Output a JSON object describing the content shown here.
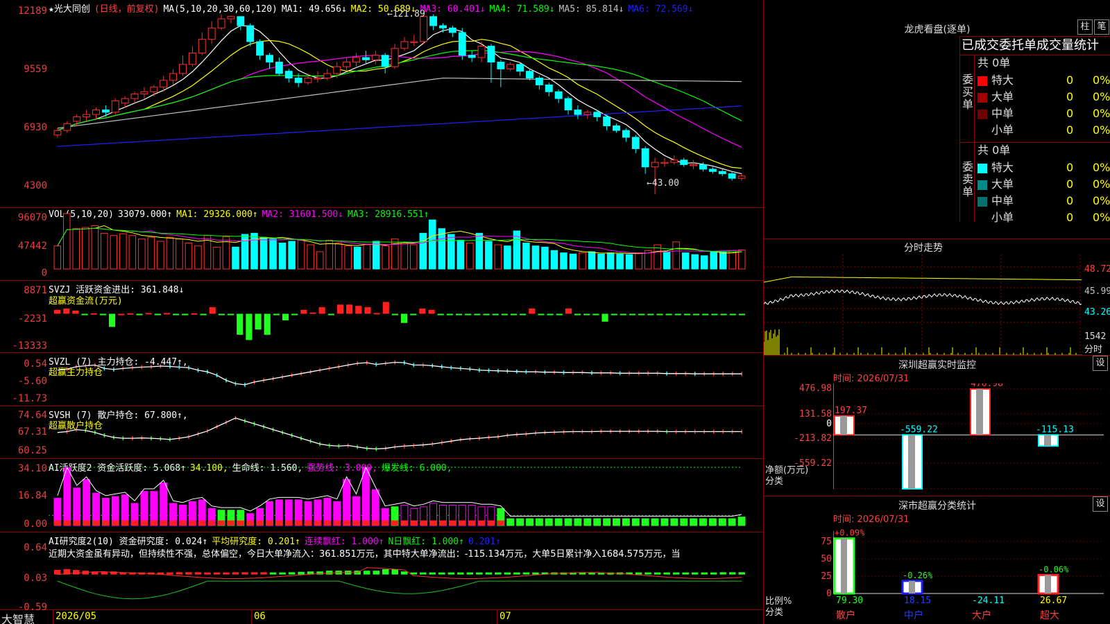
{
  "main": {
    "title": "★光大同创",
    "mode": "(日线，前复权)",
    "ma_label": "MA(5,10,20,30,60,120)",
    "ma": [
      {
        "text": "MA1: 49.656↓",
        "color": "#ffffff"
      },
      {
        "text": "MA2: 50.689↓",
        "color": "#ffff00"
      },
      {
        "text": "MA3: 60.401↓",
        "color": "#ff00ff"
      },
      {
        "text": "MA4: 71.589↓",
        "color": "#00ff00"
      },
      {
        "text": "MA5: 85.814↓",
        "color": "#c0c0c0"
      },
      {
        "text": "MA6: 72.569↓",
        "color": "#2020ff"
      }
    ],
    "y_ticks": [
      "12189",
      "9559",
      "6930",
      "4300"
    ],
    "high_note": "121.89",
    "low_note": "43.00"
  },
  "vol": {
    "label": "VOL(5,10,20)",
    "value": "33079.000↑",
    "ma": [
      {
        "text": "MA1: 29326.000↑",
        "color": "#ffff00"
      },
      {
        "text": "MA2: 31601.500↓",
        "color": "#ff00ff"
      },
      {
        "text": "MA3: 28916.551↑",
        "color": "#00ff00"
      }
    ],
    "y_ticks": [
      "96070",
      "47442",
      "0"
    ]
  },
  "svzj": {
    "label": "SVZJ  活跃资金进出: 361.848↓",
    "sub": "超赢资金流(万元)",
    "y_ticks": [
      "8871",
      "-2231",
      "-13333"
    ]
  },
  "svzl": {
    "label": "SVZL (7) 主力持仓: -4.447↑,",
    "sub": "超赢主力持仓",
    "y_ticks": [
      "0.54",
      "-5.60",
      "-11.73"
    ]
  },
  "svsh": {
    "label": "SVSH (7) 散户持仓: 67.800↑,",
    "sub": "超赢散户持仓",
    "y_ticks": [
      "74.64",
      "67.31",
      "60.25"
    ]
  },
  "ai1": {
    "label": "AI活跃度2 资金活跃度: 5.068↑",
    "v2": "34.100,",
    "v3": "生命线: 1.560,",
    "v4": "强势线: 3.000,",
    "v5": "爆发线: 6.000,",
    "y_ticks": [
      "34.10",
      "16.84",
      "0.00"
    ]
  },
  "ai2": {
    "label": "AI研究度2(10) 资金研究度: 0.024↑",
    "v2": "平均研究度: 0.201↑",
    "v3": "连续飘红: 1.000↑",
    "v4": "N日飘红: 1.000↑",
    "v5": "0.201↑",
    "text": "近期大资金虽有异动，但持续性不强，总体偏空，今日大单净流入：361.851万元，其中特大单净流出：-115.134万元，大单5日累计净入1684.575万元，当",
    "y_ticks": [
      "0.64",
      "0.03",
      "-0.59"
    ]
  },
  "bottom": {
    "brand": "大智慧",
    "dates": [
      "2026/05",
      "06",
      "07"
    ]
  },
  "lhb": {
    "title": "龙虎看盘(逐单)",
    "btn1": "柱",
    "btn2": "笔",
    "tabs": "已成交委托单成交量统计",
    "buy_label": "委买单",
    "sell_label": "委卖单",
    "buy_total": "共 0单",
    "sell_total": "共 0单",
    "buy_rows": [
      {
        "name": "特大",
        "v": "0",
        "p": "0%",
        "color": "#ff0000"
      },
      {
        "name": "大单",
        "v": "0",
        "p": "0%",
        "color": "#a00000"
      },
      {
        "name": "中单",
        "v": "0",
        "p": "0%",
        "color": "#700000"
      },
      {
        "name": "小单",
        "v": "0",
        "p": "0%",
        "color": "#000000"
      }
    ],
    "sell_rows": [
      {
        "name": "特大",
        "v": "0",
        "p": "0%",
        "color": "#00ffff"
      },
      {
        "name": "大单",
        "v": "0",
        "p": "0%",
        "color": "#008b8b"
      },
      {
        "name": "中单",
        "v": "0",
        "p": "0%",
        "color": "#007070"
      },
      {
        "name": "小单",
        "v": "0",
        "p": "0%",
        "color": "#000000"
      }
    ]
  },
  "fs": {
    "title": "分时走势",
    "y": [
      "48.72",
      "45.99",
      "43.26",
      "1542"
    ],
    "unit": "分时"
  },
  "sz": {
    "title": "深圳超赢实时监控",
    "btn": "设",
    "time": "时间: 2026/07/31",
    "y": [
      "476.98",
      "131.58",
      "0",
      "-213.82",
      "-559.22"
    ],
    "unit1": "净额(万元)",
    "unit2": "分类",
    "bars": [
      {
        "cat": "散户",
        "val": "197.37"
      },
      {
        "cat": "中户",
        "val": "-559.22"
      },
      {
        "cat": "大户",
        "val": "476.98"
      },
      {
        "cat": "超大",
        "val": "-115.13"
      }
    ]
  },
  "fl": {
    "title": "深市超赢分类统计",
    "btn": "设",
    "time": "时间: 2026/07/31",
    "y": [
      "75",
      "50",
      "25",
      "0"
    ],
    "unit1": "比例%",
    "unit2": "分类",
    "bars": [
      {
        "cat": "散户",
        "pct": "+0.09%",
        "val": "79.30"
      },
      {
        "cat": "中户",
        "pct": "-0.26%",
        "val": "18.15"
      },
      {
        "cat": "大户",
        "pct": "",
        "val": "-24.11"
      },
      {
        "cat": "超大",
        "pct": "-0.06%",
        "val": "26.67"
      }
    ]
  },
  "chart_data": [
    {
      "type": "candlestick",
      "title": "光大同创 日线 前复权",
      "ylim": [
        43.0,
        121.89
      ],
      "candles": [
        [
          69,
          71,
          72,
          68
        ],
        [
          71,
          74,
          75,
          70
        ],
        [
          75,
          77,
          78,
          73
        ],
        [
          77,
          78,
          80,
          75
        ],
        [
          78,
          80,
          81,
          76
        ],
        [
          80,
          79,
          82,
          77
        ],
        [
          79,
          84,
          85,
          78
        ],
        [
          83,
          85,
          86,
          81
        ],
        [
          85,
          87,
          88,
          83
        ],
        [
          87,
          88,
          90,
          85
        ],
        [
          88,
          90,
          91,
          86
        ],
        [
          90,
          93,
          95,
          88
        ],
        [
          93,
          96,
          98,
          91
        ],
        [
          96,
          100,
          104,
          95
        ],
        [
          100,
          105,
          108,
          99
        ],
        [
          105,
          111,
          114,
          104
        ],
        [
          111,
          116,
          119,
          109
        ],
        [
          116,
          120,
          121.89,
          115
        ],
        [
          120,
          121,
          121.5,
          118
        ],
        [
          121,
          117,
          121,
          115
        ],
        [
          117,
          110,
          118,
          108
        ],
        [
          110,
          104,
          111,
          102
        ],
        [
          104,
          101,
          105,
          98
        ],
        [
          101,
          96,
          103,
          95
        ],
        [
          97,
          94,
          98,
          92
        ],
        [
          94,
          92,
          96,
          90
        ],
        [
          92,
          94,
          96,
          91
        ],
        [
          94,
          94,
          97,
          92
        ],
        [
          94,
          96,
          98,
          93
        ],
        [
          96,
          99,
          101,
          94
        ],
        [
          99,
          101,
          103,
          97
        ],
        [
          101,
          103,
          105,
          99
        ],
        [
          103,
          102,
          106,
          100
        ],
        [
          102,
          104,
          106,
          100
        ],
        [
          104,
          99,
          105,
          96
        ],
        [
          99,
          107,
          109,
          98
        ],
        [
          107,
          110,
          112,
          106
        ],
        [
          110,
          110,
          113,
          108
        ],
        [
          110,
          121,
          122,
          109
        ],
        [
          121,
          117,
          122,
          115
        ],
        [
          117,
          116,
          118,
          114
        ],
        [
          116,
          114,
          117,
          112
        ],
        [
          114,
          104,
          116,
          102
        ],
        [
          104,
          103,
          106,
          101
        ],
        [
          103,
          108,
          110,
          101
        ],
        [
          108,
          101,
          109,
          92
        ],
        [
          101,
          98,
          102,
          90
        ],
        [
          98,
          100,
          101,
          97
        ],
        [
          100,
          97,
          101,
          95
        ],
        [
          97,
          94,
          98,
          93
        ],
        [
          94,
          91,
          95,
          89
        ],
        [
          91,
          88,
          92,
          86
        ],
        [
          88,
          85,
          89,
          83
        ],
        [
          85,
          80,
          86,
          78
        ],
        [
          80,
          78,
          82,
          76
        ],
        [
          78,
          79,
          80,
          76
        ],
        [
          79,
          77,
          80,
          75
        ],
        [
          77,
          73,
          78,
          71
        ],
        [
          73,
          71,
          74,
          70
        ],
        [
          71,
          68,
          72,
          66
        ],
        [
          68,
          63,
          69,
          61
        ],
        [
          63,
          55,
          64,
          52
        ],
        [
          55,
          57,
          59,
          43
        ],
        [
          57,
          57,
          59,
          55
        ],
        [
          57,
          58,
          60,
          56
        ],
        [
          58,
          56,
          59,
          55
        ],
        [
          56,
          56,
          58,
          54
        ],
        [
          56,
          54,
          57,
          53
        ],
        [
          54,
          53,
          55,
          52
        ],
        [
          53,
          52,
          54,
          51
        ],
        [
          52,
          50,
          53,
          49
        ],
        [
          50,
          51,
          52,
          49
        ]
      ]
    },
    {
      "type": "bar",
      "title": "VOL(5,10,20)",
      "ylim": [
        0,
        96070
      ],
      "values": [
        40000,
        96070,
        70000,
        72000,
        75000,
        62000,
        58000,
        61000,
        58000,
        52000,
        55000,
        48000,
        55000,
        52000,
        45000,
        40000,
        58000,
        38000,
        56000,
        38000,
        60000,
        62000,
        55000,
        52000,
        45000,
        48000,
        50000,
        42000,
        30000,
        50000,
        45000,
        40000,
        38000,
        42000,
        48000,
        40000,
        52000,
        45000,
        42000,
        62000,
        85000,
        70000,
        60000,
        50000,
        45000,
        62000,
        48000,
        42000,
        40000,
        66000,
        45000,
        40000,
        38000,
        32000,
        28000,
        26000,
        28000,
        30000,
        26000,
        28000,
        26000,
        25000,
        28000,
        32000,
        42000,
        30000,
        47000,
        28000,
        25000,
        23000,
        30000,
        30000,
        32000,
        33079
      ],
      "up": [
        1,
        1,
        1,
        1,
        1,
        1,
        1,
        1,
        1,
        1,
        1,
        1,
        1,
        1,
        1,
        1,
        1,
        1,
        1,
        0,
        0,
        0,
        0,
        0,
        0,
        0,
        1,
        1,
        1,
        1,
        1,
        1,
        0,
        1,
        0,
        1,
        1,
        1,
        1,
        0,
        0,
        0,
        0,
        0,
        1,
        0,
        0,
        1,
        0,
        0,
        0,
        0,
        0,
        0,
        0,
        0,
        1,
        0,
        0,
        0,
        0,
        0,
        1,
        1,
        1,
        0,
        1,
        0,
        0,
        0,
        0,
        0,
        1,
        1
      ]
    },
    {
      "type": "bar",
      "title": "超赢资金流(万元)",
      "ylim": [
        -13333,
        8871
      ],
      "values": [
        1500,
        2000,
        1200,
        -200,
        200,
        -300,
        -5000,
        0,
        200,
        -200,
        300,
        -200,
        300,
        -400,
        -300,
        200,
        -300,
        2500,
        -200,
        -300,
        -8000,
        -10000,
        -6000,
        -8000,
        -200,
        -2500,
        -300,
        1500,
        500,
        2500,
        -300,
        3500,
        3500,
        3000,
        2500,
        300,
        4500,
        -200,
        -3500,
        -300,
        2000,
        1500,
        -200,
        -200,
        -200,
        -200,
        -200,
        -200,
        -200,
        -200,
        -200,
        -200,
        2000,
        -200,
        -200,
        -200,
        2000,
        -200,
        -200,
        -200,
        -3000,
        -200,
        -200,
        -200,
        -200,
        -200,
        -200,
        -200,
        -200,
        -200,
        -200,
        -200,
        -200,
        -200,
        -200,
        -200
      ],
      "sign": "positive=red, negative=green"
    },
    {
      "type": "line",
      "title": "超赢主力持仓",
      "ylim": [
        -11.73,
        0.54
      ],
      "values": [
        -2.5,
        -2.2,
        -1.5,
        -1.2,
        -1.0,
        -2.0,
        -2.3,
        -2.0,
        -1.8,
        -1.6,
        -1.5,
        -1.3,
        -1.4,
        -1.6,
        -1.8,
        -2.5,
        -3.0,
        -4.0,
        -5.5,
        -6.5,
        -6.8,
        -6.0,
        -5.5,
        -5.0,
        -4.5,
        -4.0,
        -3.5,
        -3.0,
        -2.5,
        -2.0,
        -1.5,
        -1.0,
        -0.5,
        -0.3,
        -0.8,
        -0.5,
        -0.2,
        -0.3,
        -1.0,
        -1.0,
        -1.2,
        -1.5,
        -1.8,
        -2.0,
        -2.2,
        -2.5,
        -2.6,
        -2.7,
        -2.8,
        -2.9,
        -3.0,
        -3.0,
        -3.1,
        -3.1,
        -3.2,
        -3.2,
        -3.2,
        -3.3,
        -3.3,
        -3.3,
        -3.4,
        -3.4,
        -3.4,
        -3.4,
        -3.4,
        -3.5,
        -3.5,
        -3.5,
        -3.6,
        -3.6,
        -3.6,
        -3.6,
        -3.6,
        -3.6
      ]
    },
    {
      "type": "line",
      "title": "超赢散户持仓",
      "ylim": [
        60.25,
        74.64
      ],
      "values": [
        67.5,
        67.8,
        68.5,
        68.2,
        67.5,
        66.5,
        65.8,
        65.5,
        65.5,
        65.6,
        65.5,
        65.3,
        65.1,
        65.5,
        66.0,
        67.0,
        68.0,
        69.5,
        71.0,
        72.5,
        71.5,
        70.5,
        69.5,
        68.5,
        67.5,
        66.5,
        65.5,
        64.5,
        63.5,
        63.0,
        62.8,
        63.0,
        62.5,
        62.0,
        61.8,
        62.0,
        62.5,
        62.8,
        63.0,
        63.2,
        63.5,
        64.0,
        64.5,
        65.0,
        65.3,
        65.5,
        65.8,
        66.0,
        66.5,
        66.8,
        67.0,
        67.3,
        67.5,
        67.6,
        67.7,
        67.8,
        67.8,
        67.8,
        67.9,
        67.9,
        67.9,
        67.9,
        67.9,
        67.9,
        67.9,
        67.8,
        67.8,
        67.8,
        67.8,
        67.8,
        67.8,
        67.8,
        67.8,
        67.8
      ]
    },
    {
      "type": "bar",
      "title": "AI活跃度2",
      "ylim": [
        0,
        34.1
      ],
      "values": [
        16,
        34,
        22,
        27,
        19,
        16,
        17,
        18,
        13,
        20,
        20,
        25,
        13,
        12,
        14,
        15,
        10,
        9,
        9,
        9,
        7,
        10,
        14,
        15,
        15,
        15,
        14,
        15,
        16,
        14,
        27,
        17,
        34,
        21,
        10,
        11,
        12,
        10,
        11,
        13,
        12,
        12,
        12,
        12,
        11,
        11,
        10,
        4,
        4,
        4,
        4,
        4,
        4,
        4,
        4,
        4,
        4,
        4,
        4,
        4,
        4,
        4,
        4,
        4,
        4,
        4,
        4,
        4,
        4,
        4,
        4,
        5
      ],
      "lines": {
        "强势线": 3.0,
        "爆发线": 6.0,
        "34.100": 34.1
      }
    },
    {
      "type": "bar",
      "title": "AI研究度2(10)",
      "ylim": [
        -0.59,
        0.64
      ],
      "values": [
        0.12,
        0.14,
        0.12,
        0.1,
        0.08,
        0.07,
        0.08,
        0.05,
        0.04,
        0.04,
        0.03,
        0.04,
        0.05,
        0.06,
        0.06,
        0.06,
        0.05,
        0.05,
        0.05,
        0.06,
        0.06,
        0.06,
        0.06,
        0.05,
        0.05,
        0.06,
        0.07,
        0.08,
        0.08,
        0.1,
        0.1,
        0.1,
        0.1,
        0.1,
        0.1,
        0.14,
        0.14,
        0.08,
        0.05,
        0.05,
        0.05,
        0.05,
        0.05,
        0.05,
        0.05,
        0.05,
        0.05,
        0.05,
        0.05,
        0.05,
        0.05,
        0.05,
        0.05,
        0.05,
        0.05,
        0.05,
        0.05,
        0.05,
        0.05,
        0.05,
        0.05,
        0.05,
        0.05,
        0.05,
        0.05,
        0.05,
        0.05,
        0.05,
        0.05,
        0.05,
        0.05,
        0.06,
        0.06,
        0.06
      ],
      "red_bars_first": 23
    }
  ]
}
